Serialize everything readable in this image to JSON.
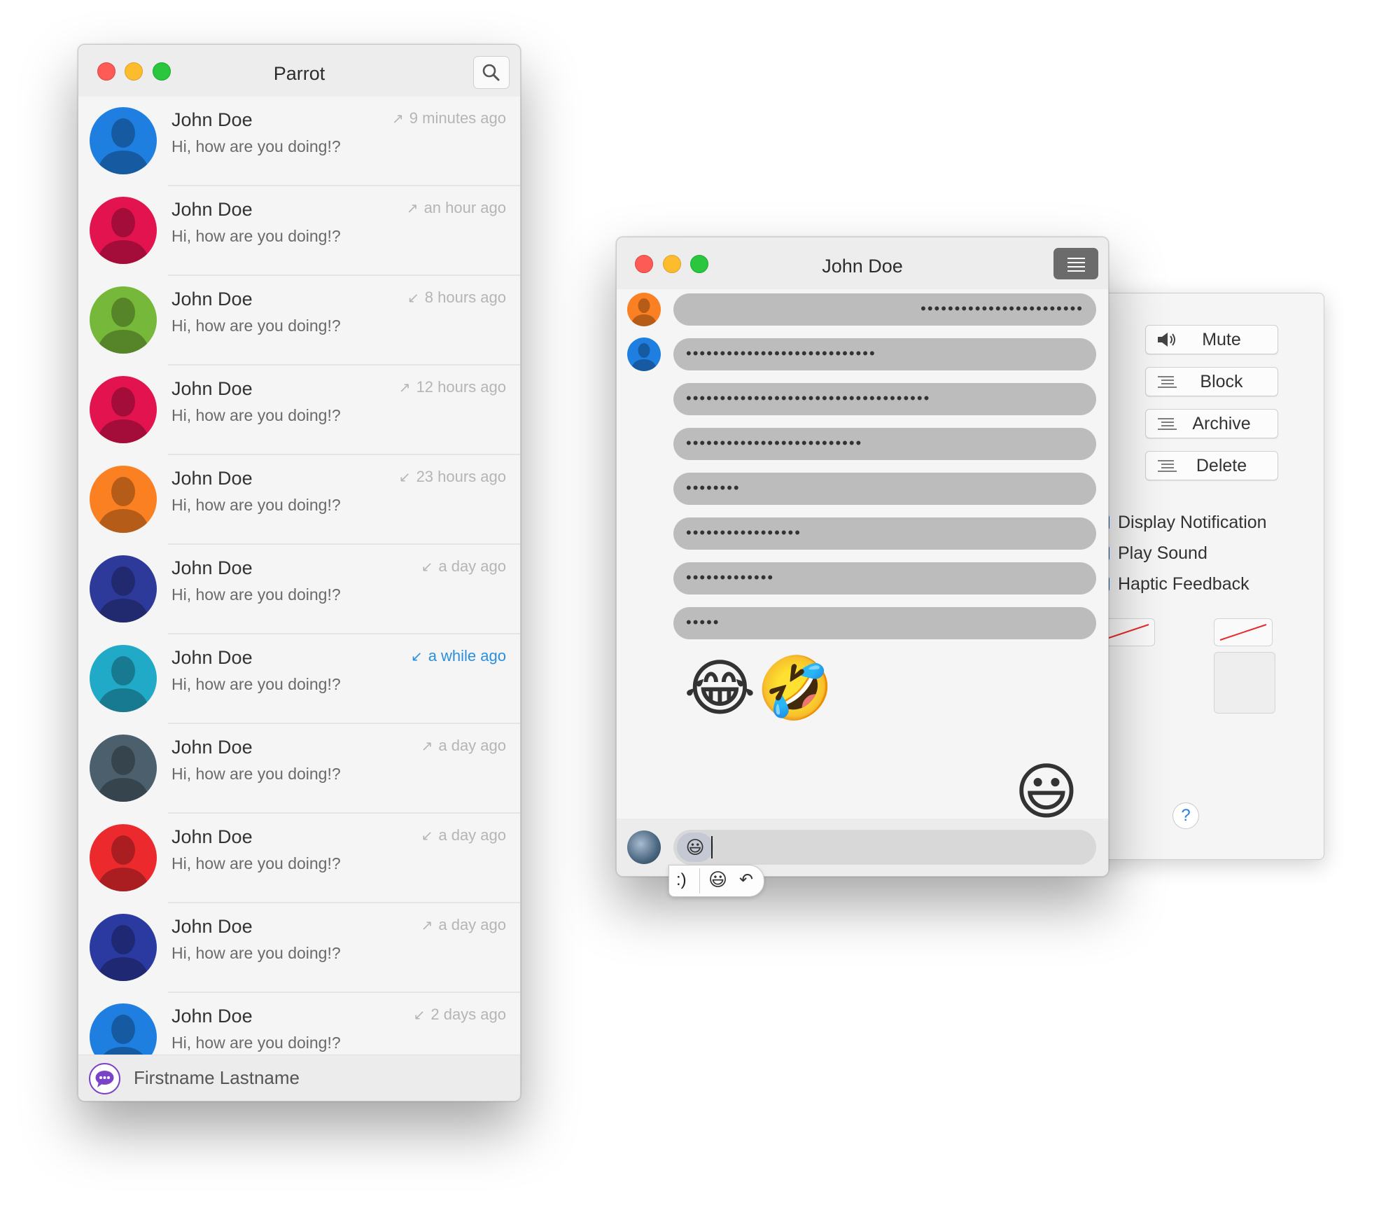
{
  "list_window": {
    "title": "Parrot",
    "conversations": [
      {
        "name": "John Doe",
        "message": "Hi, how are you doing!?",
        "time": "9 minutes ago",
        "arrow": "↗",
        "color": "#1f7fe0",
        "highlight": false
      },
      {
        "name": "John Doe",
        "message": "Hi, how are you doing!?",
        "time": "an hour ago",
        "arrow": "↗",
        "color": "#e3134f",
        "highlight": false
      },
      {
        "name": "John Doe",
        "message": "Hi, how are you doing!?",
        "time": "8 hours ago",
        "arrow": "↙",
        "color": "#76b83a",
        "highlight": false
      },
      {
        "name": "John Doe",
        "message": "Hi, how are you doing!?",
        "time": "12 hours ago",
        "arrow": "↗",
        "color": "#e3134f",
        "highlight": false
      },
      {
        "name": "John Doe",
        "message": "Hi, how are you doing!?",
        "time": "23 hours ago",
        "arrow": "↙",
        "color": "#fb8022",
        "highlight": false
      },
      {
        "name": "John Doe",
        "message": "Hi, how are you doing!?",
        "time": "a day ago",
        "arrow": "↙",
        "color": "#2e3a9a",
        "highlight": false
      },
      {
        "name": "John Doe",
        "message": "Hi, how are you doing!?",
        "time": "a while ago",
        "arrow": "↙",
        "color": "#20aac8",
        "highlight": true
      },
      {
        "name": "John Doe",
        "message": "Hi, how are you doing!?",
        "time": "a day ago",
        "arrow": "↗",
        "color": "#4b5f6d",
        "highlight": false
      },
      {
        "name": "John Doe",
        "message": "Hi, how are you doing!?",
        "time": "a day ago",
        "arrow": "↙",
        "color": "#ec2a2e",
        "highlight": false
      },
      {
        "name": "John Doe",
        "message": "Hi, how are you doing!?",
        "time": "a day ago",
        "arrow": "↗",
        "color": "#2b3aa0",
        "highlight": false
      },
      {
        "name": "John Doe",
        "message": "Hi, how are you doing!?",
        "time": "2 days ago",
        "arrow": "↙",
        "color": "#1f7fe0",
        "highlight": false
      }
    ],
    "footer_name": "Firstname Lastname"
  },
  "chat_window": {
    "title": "John Doe",
    "messages": [
      {
        "dots": "••••••••••••••••••••••••",
        "align": "right",
        "avatar_color": "#fb8022"
      },
      {
        "dots": "••••••••••••••••••••••••••••",
        "align": "left",
        "avatar_color": "#1f7fe0"
      },
      {
        "dots": "••••••••••••••••••••••••••••••••••••",
        "align": "left",
        "avatar_color": ""
      },
      {
        "dots": "••••••••••••••••••••••••••",
        "align": "left",
        "avatar_color": ""
      },
      {
        "dots": "••••••••",
        "align": "left",
        "avatar_color": ""
      },
      {
        "dots": "•••••••••••••••••",
        "align": "left",
        "avatar_color": ""
      },
      {
        "dots": "•••••••••••••",
        "align": "left",
        "avatar_color": ""
      },
      {
        "dots": "•••••",
        "align": "left",
        "avatar_color": ""
      }
    ],
    "emoji_left_1": "😂",
    "emoji_left_2": "🤣",
    "emoji_right": "😃",
    "input_value": "😃",
    "replacement_popover": {
      "text": ":)",
      "emoji": "😃",
      "undo": "↶"
    }
  },
  "settings_panel": {
    "buttons": [
      {
        "label": "Mute",
        "icon": "speaker-icon"
      },
      {
        "label": "Block",
        "icon": "list-icon"
      },
      {
        "label": "Archive",
        "icon": "list-icon"
      },
      {
        "label": "Delete",
        "icon": "list-icon"
      }
    ],
    "checkboxes": [
      {
        "label": "Display Notification",
        "checked": true
      },
      {
        "label": "Play Sound",
        "checked": true
      },
      {
        "label": "Haptic Feedback",
        "checked": true
      }
    ],
    "help_label": "?"
  },
  "colors": {
    "accent": "#2a7fe0",
    "bubble": "#bcbcbc",
    "close": "#fd5b55",
    "minimize": "#fdbb2e",
    "zoom": "#2cc63e"
  }
}
